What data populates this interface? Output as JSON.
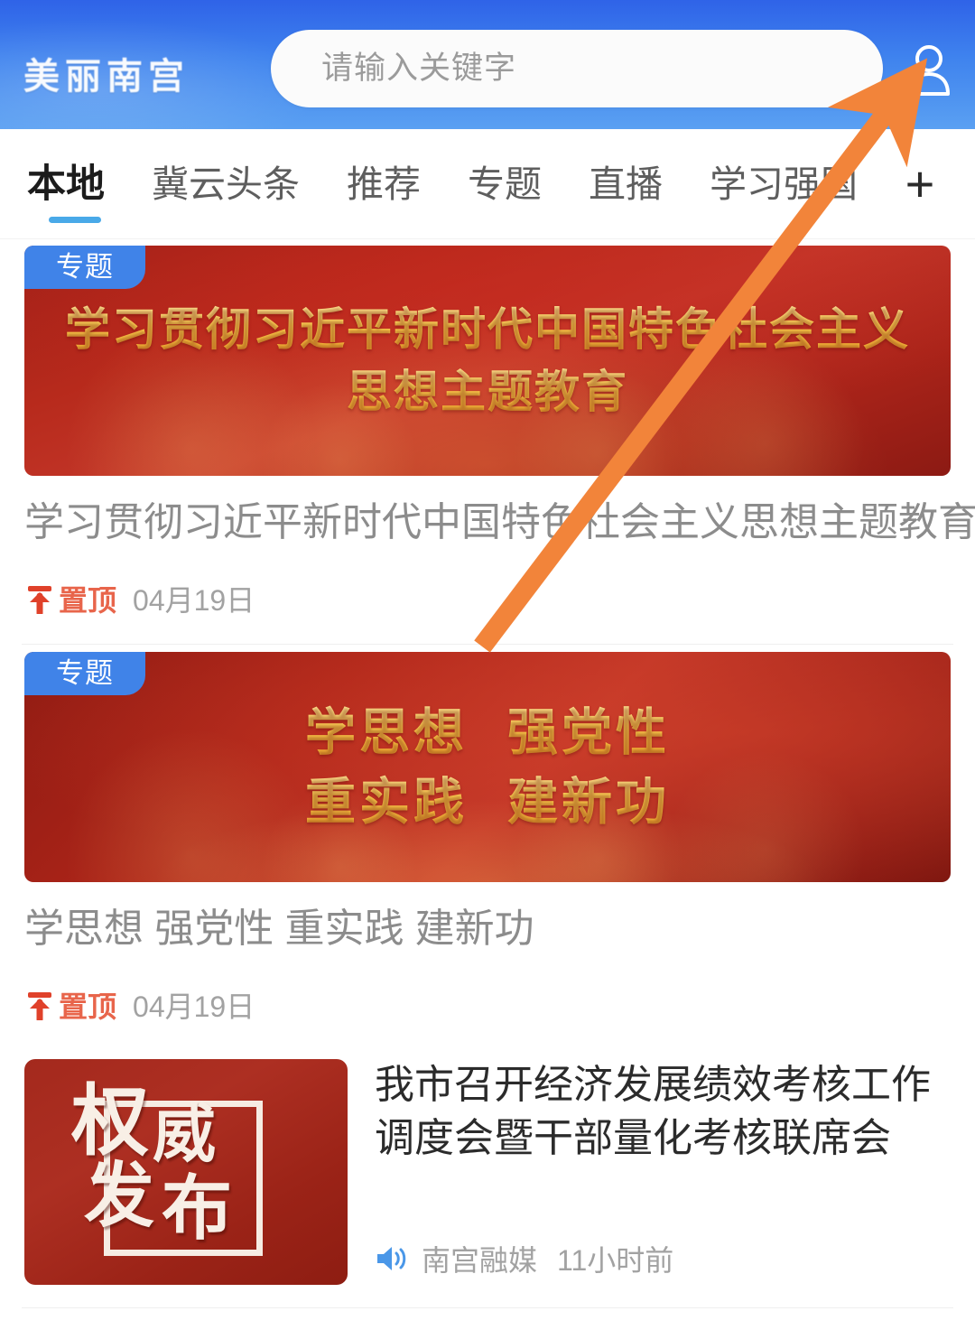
{
  "header": {
    "brand_logo_text": "美丽南宫",
    "search": {
      "placeholder": "请输入关键字",
      "value": ""
    },
    "profile_icon": "user-icon",
    "background_color": "#3f83ee"
  },
  "tabbar": {
    "tabs": [
      {
        "label": "本地",
        "active": true
      },
      {
        "label": "冀云头条",
        "active": false
      },
      {
        "label": "推荐",
        "active": false
      },
      {
        "label": "专题",
        "active": false
      },
      {
        "label": "直播",
        "active": false
      },
      {
        "label": "学习强国",
        "active": false
      }
    ],
    "add_tab_label": "+",
    "active_indicator_color": "#49a9e8"
  },
  "feed": {
    "items": [
      {
        "type": "banner",
        "badge": "专题",
        "banner_lines": [
          "学习贯彻习近平新时代中国特色社会主义",
          "思想主题教育"
        ],
        "title": "学习贯彻习近平新时代中国特色社会主义思想主题教育",
        "pin_label": "置顶",
        "date": "04月19日"
      },
      {
        "type": "banner",
        "badge": "专题",
        "banner_lines_a": [
          "学思想",
          "强党性"
        ],
        "banner_lines_b": [
          "重实践",
          "建新功"
        ],
        "title": "学思想 强党性 重实践 建新功",
        "pin_label": "置顶",
        "date": "04月19日"
      },
      {
        "type": "list",
        "thumb_chars": [
          "权",
          "威",
          "发",
          "布"
        ],
        "title": "我市召开经济发展绩效考核工作调度会暨干部量化考核联席会",
        "source": "南宫融媒",
        "time_ago": "11小时前",
        "audio_icon": "speaker-icon"
      }
    ]
  },
  "annotation": {
    "arrow_color": "#f28a3c",
    "arrow_from": "body-area",
    "arrow_to": "profile-icon"
  },
  "colors": {
    "badge_blue": "#4083e8",
    "pin_red": "#e8654b",
    "banner_red": "#b72a1c",
    "banner_gold": "#ffd04f",
    "meta_gray": "#a2a2a2"
  }
}
